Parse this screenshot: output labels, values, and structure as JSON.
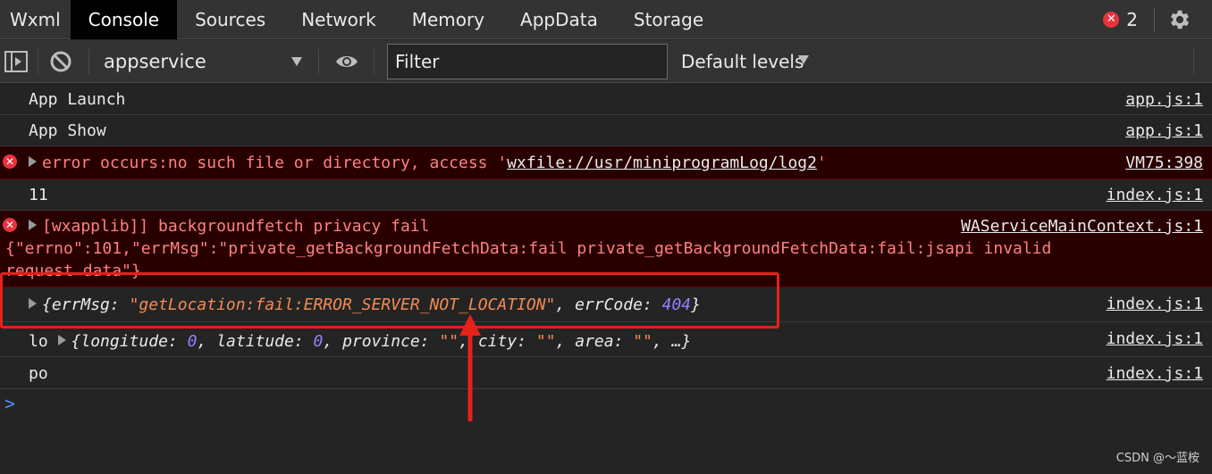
{
  "tabs": [
    "Wxml",
    "Console",
    "Sources",
    "Network",
    "Memory",
    "AppData",
    "Storage"
  ],
  "active_tab": "Console",
  "error_count": "2",
  "toolbar": {
    "context": "appservice",
    "filter_placeholder": "Filter",
    "levels": "Default levels"
  },
  "console": {
    "row1": {
      "msg": "App Launch",
      "src": "app.js:1"
    },
    "row2": {
      "msg": "App Show",
      "src": "app.js:1"
    },
    "row3": {
      "msg_prefix": "error occurs:no such file or directory, access '",
      "link": "wxfile://usr/miniprogramLog/log2",
      "msg_suffix": "'",
      "src": "VM75:398"
    },
    "row4": {
      "msg": "11",
      "src": "index.js:1"
    },
    "row5": {
      "line1": "[wxapplib]] backgroundfetch privacy fail",
      "line2": "{\"errno\":101,\"errMsg\":\"private_getBackgroundFetchData:fail private_getBackgroundFetchData:fail:jsapi invalid",
      "line3": "request data\"}",
      "src": "WAServiceMainContext.js:1"
    },
    "row6": {
      "open": "{",
      "key1": "errMsg",
      "val1": "\"getLocation:fail:ERROR_SERVER_NOT_LOCATION\"",
      "key2": "errCode",
      "val2": "404",
      "close": "}",
      "src": "index.js:1"
    },
    "row7": {
      "label": "lo",
      "open": "{",
      "k1": "longitude",
      "v1": "0",
      "k2": "latitude",
      "v2": "0",
      "k3": "province",
      "v3": "\"\"",
      "k4": "city",
      "v4": "\"\"",
      "k5": "area",
      "v5": "\"\"",
      "tail": ", …}",
      "src": "index.js:1"
    },
    "row8": {
      "msg": "po",
      "src": "index.js:1"
    }
  },
  "prompt": ">",
  "watermark": "CSDN @～蓝桉",
  "colors": {
    "error_bg": "#290000",
    "error_text": "#ff8080",
    "highlight_box": "#e6211a",
    "string": "#f28b54",
    "number": "#9980ff"
  }
}
